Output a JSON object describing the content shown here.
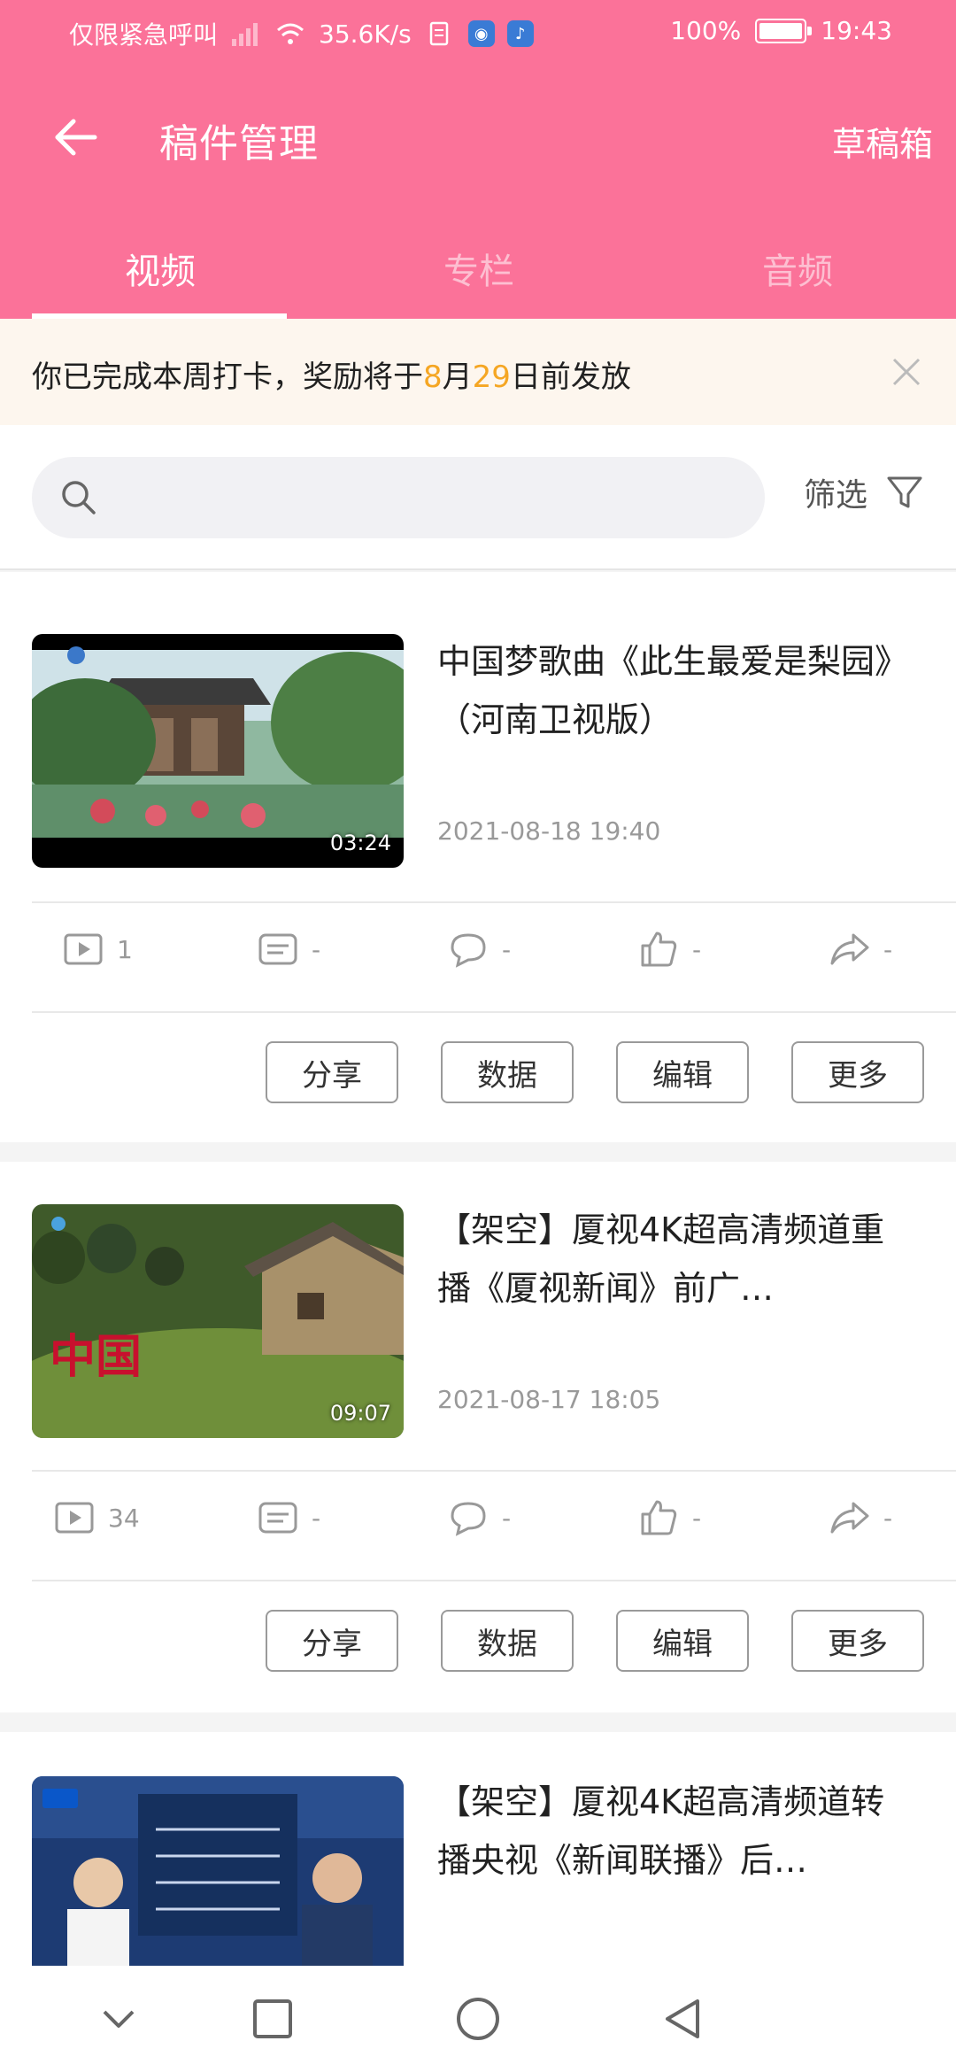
{
  "status_bar": {
    "emergency_text": "仅限紧急呼叫",
    "speed": "35.6K/s",
    "battery_percent": "100%",
    "battery_level": 1.0,
    "time": "19:43"
  },
  "header": {
    "title": "稿件管理",
    "drafts_label": "草稿箱",
    "back_icon": "arrow-left-icon",
    "accent_color": "#fb7299"
  },
  "tabs": [
    {
      "label": "视频",
      "active": true
    },
    {
      "label": "专栏",
      "active": false
    },
    {
      "label": "音频",
      "active": false
    }
  ],
  "notice": {
    "text_before": "你已完成本周打卡，奖励将于",
    "month": "8",
    "month_unit": "月",
    "day": "29",
    "text_after": "日前发放",
    "highlight_color": "#f5a623"
  },
  "search": {
    "placeholder": "",
    "filter_label": "筛选"
  },
  "videos": [
    {
      "title": "中国梦歌曲《此生最爱是梨园》（河南卫视版）",
      "date": "2021-08-18  19:40",
      "duration": "03:24",
      "plays": "1",
      "danmaku": "-",
      "comments": "-",
      "likes": "-",
      "shares": "-"
    },
    {
      "title": "【架空】厦视4K超高清频道重播《厦视新闻》前广…",
      "date": "2021-08-17  18:05",
      "duration": "09:07",
      "plays": "34",
      "danmaku": "-",
      "comments": "-",
      "likes": "-",
      "shares": "-"
    },
    {
      "title": "【架空】厦视4K超高清频道转播央视《新闻联播》后…"
    }
  ],
  "actions": {
    "share": "分享",
    "data": "数据",
    "edit": "编辑",
    "more": "更多"
  }
}
